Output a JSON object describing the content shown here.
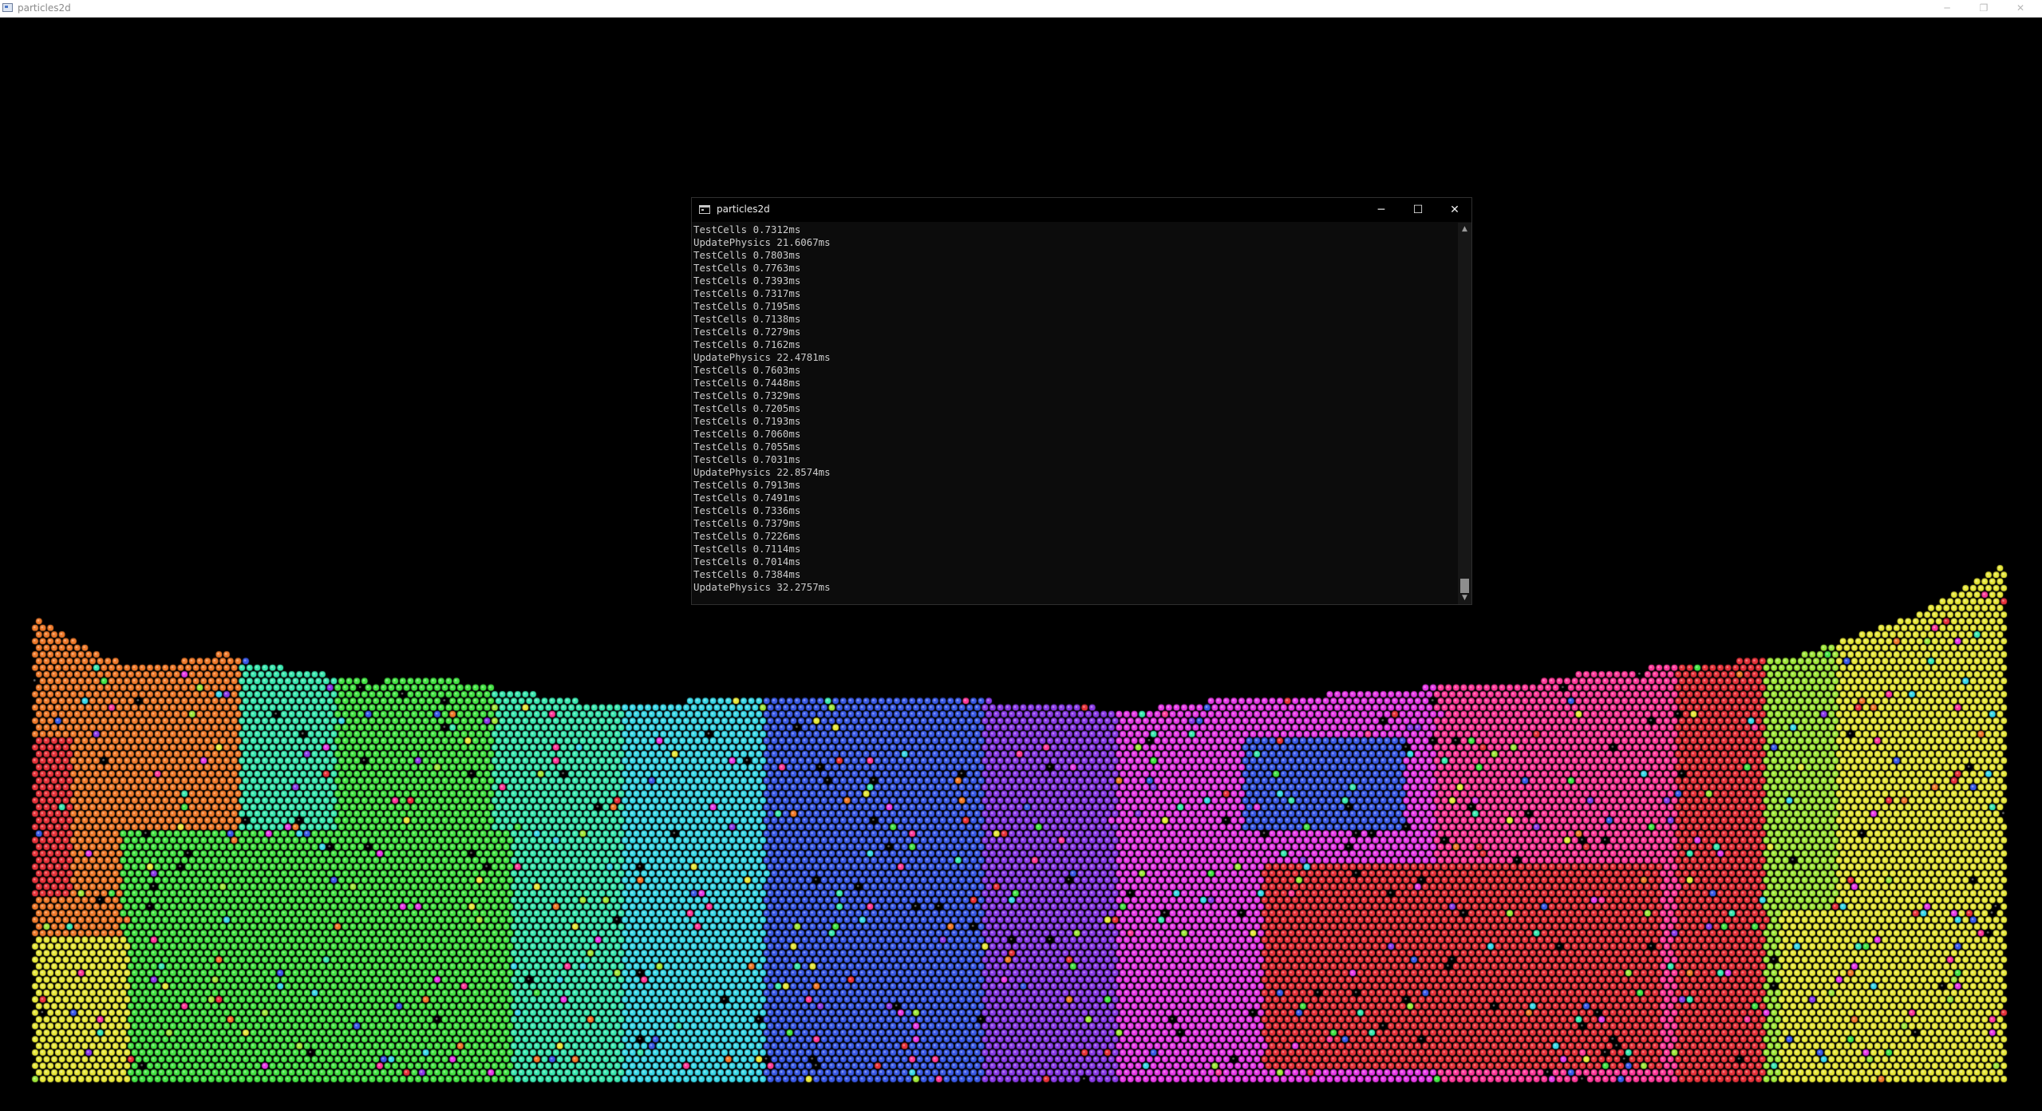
{
  "outer_window": {
    "title": "particles2d",
    "controls": {
      "minimize": "─",
      "maximize": "❐",
      "close": "✕"
    }
  },
  "console_window": {
    "title": "particles2d",
    "controls": {
      "minimize": "─",
      "maximize": "☐",
      "close": "✕"
    },
    "scrollbar": {
      "up": "▲",
      "down": "▼"
    },
    "log_lines": [
      "TestCells 0.7312ms",
      "UpdatePhysics 21.6067ms",
      "TestCells 0.7803ms",
      "TestCells 0.7763ms",
      "TestCells 0.7393ms",
      "TestCells 0.7317ms",
      "TestCells 0.7195ms",
      "TestCells 0.7138ms",
      "TestCells 0.7279ms",
      "TestCells 0.7162ms",
      "UpdatePhysics 22.4781ms",
      "TestCells 0.7603ms",
      "TestCells 0.7448ms",
      "TestCells 0.7329ms",
      "TestCells 0.7205ms",
      "TestCells 0.7193ms",
      "TestCells 0.7060ms",
      "TestCells 0.7055ms",
      "TestCells 0.7031ms",
      "UpdatePhysics 22.8574ms",
      "TestCells 0.7913ms",
      "TestCells 0.7491ms",
      "TestCells 0.7336ms",
      "TestCells 0.7379ms",
      "TestCells 0.7226ms",
      "TestCells 0.7114ms",
      "TestCells 0.7014ms",
      "TestCells 0.7384ms",
      "UpdatePhysics 32.2757ms"
    ]
  },
  "simulation": {
    "background": "#000000",
    "palette": {
      "orange": "#f07a2a",
      "red": "#e8323a",
      "yellow": "#e8e83a",
      "green": "#44e444",
      "teal": "#3ae8b0",
      "cyan": "#3ad8e8",
      "blue": "#3a5ae8",
      "violet": "#8a3ae8",
      "magenta": "#e83ae8",
      "pink": "#ff3a9a",
      "lime": "#a0e83a"
    }
  }
}
